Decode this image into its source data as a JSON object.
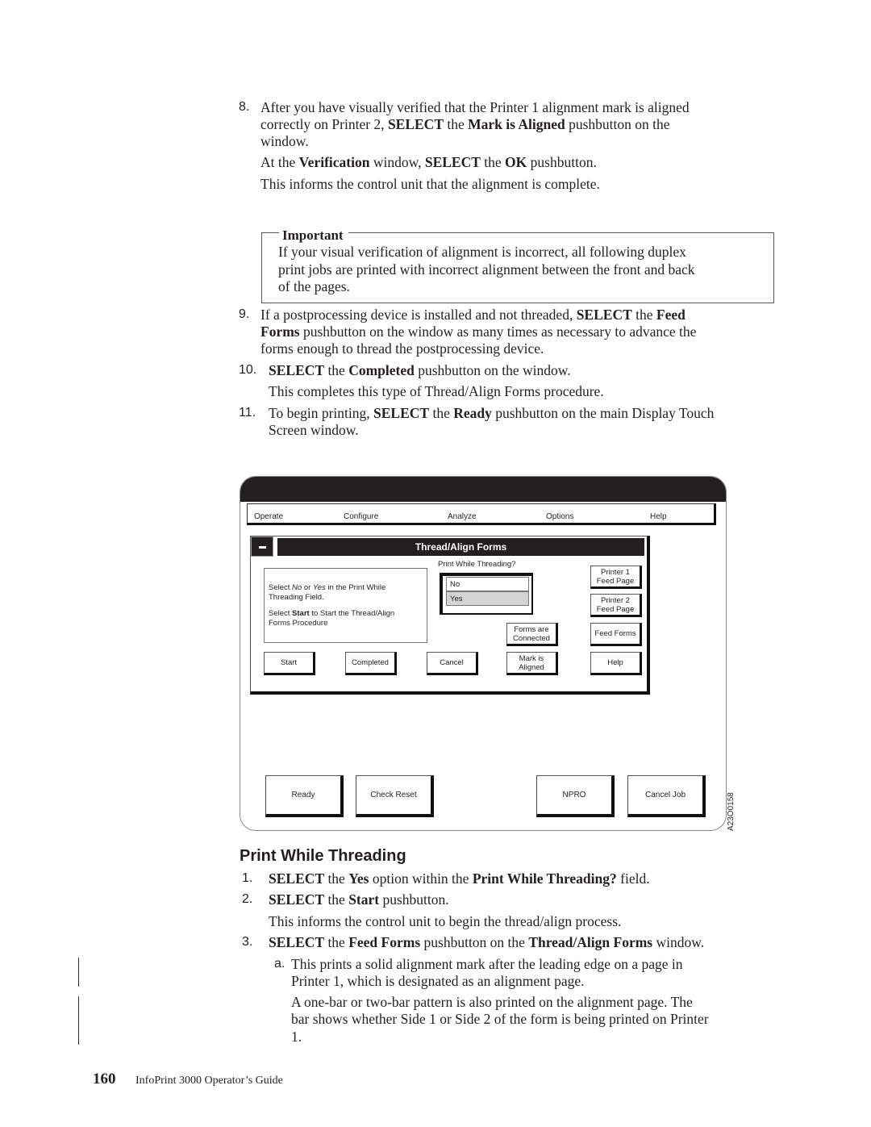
{
  "steps_top": [
    {
      "number": "8.",
      "lines": [
        "After you have visually verified that the Printer 1 alignment mark is aligned",
        [
          "correctly on Printer 2, ",
          {
            "b": "SELECT"
          },
          " the ",
          {
            "b": "Mark is Aligned"
          },
          " pushbutton on the"
        ],
        "window."
      ],
      "para2": [
        [
          "At the ",
          {
            "b": "Verification"
          },
          " window, ",
          {
            "b": "SELECT"
          },
          " the ",
          {
            "b": "OK"
          },
          " pushbutton."
        ]
      ],
      "para3": "This informs the control unit that the alignment is complete."
    }
  ],
  "step8": {
    "number": "8.",
    "line1": "After you have visually verified that the Printer 1 alignment mark is aligned",
    "line2_a": "correctly on Printer 2, ",
    "line2_b": "SELECT",
    "line2_c": " the ",
    "line2_d": "Mark is Aligned",
    "line2_e": " pushbutton on the",
    "line3": "window.",
    "p2_a": "At the ",
    "p2_b": "Verification",
    "p2_c": " window, ",
    "p2_d": "SELECT",
    "p2_e": " the ",
    "p2_f": "OK",
    "p2_g": " pushbutton.",
    "p3": "This informs the control unit that the alignment is complete."
  },
  "important": {
    "label": "Important",
    "line1": "If your visual verification of alignment is incorrect, all following duplex",
    "line2": "print jobs are printed with incorrect alignment between the front and back",
    "line3": "of the pages."
  },
  "step9": {
    "number": "9.",
    "l1_a": "If a postprocessing device is installed and not threaded, ",
    "l1_b": "SELECT",
    "l1_c": " the ",
    "l1_d": "Feed",
    "l2_a": "Forms",
    "l2_b": " pushbutton on the window as many times as necessary to advance the",
    "l3": "forms enough to thread the postprocessing device."
  },
  "step10": {
    "number": "10.",
    "l1_a": "SELECT",
    "l1_b": " the ",
    "l1_c": "Completed",
    "l1_d": " pushbutton on the window.",
    "p2": "This completes this type of Thread/Align Forms procedure."
  },
  "step11": {
    "number": "11.",
    "l1_a": "To begin printing, ",
    "l1_b": "SELECT",
    "l1_c": " the ",
    "l1_d": "Ready",
    "l1_e": " pushbutton on the main Display Touch",
    "l2": "Screen window."
  },
  "screen": {
    "menu": [
      "Operate",
      "Configure",
      "Analyze",
      "Options",
      "Help"
    ],
    "dialog_title": "Thread/Align Forms",
    "info_line1_a": "Select ",
    "info_line1_b": "No",
    "info_line1_c": " or ",
    "info_line1_d": "Yes",
    "info_line1_e": " in the Print While",
    "info_line2": "Threading Field.",
    "info_line3_a": "Select ",
    "info_line3_b": "Start",
    "info_line3_c": " to Start the Thread/Align",
    "info_line4": "Forms Procedure",
    "pwt_label": "Print While Threading?",
    "pwt_options": [
      "No",
      "Yes"
    ],
    "pwt_selected": "Yes",
    "buttons": {
      "printer1_l1": "Printer 1",
      "printer1_l2": "Feed Page",
      "printer2_l1": "Printer 2",
      "printer2_l2": "Feed Page",
      "forms_connected_l1": "Forms are",
      "forms_connected_l2": "Connected",
      "feed_forms": "Feed Forms",
      "start": "Start",
      "completed": "Completed",
      "cancel": "Cancel",
      "mark_aligned_l1": "Mark is",
      "mark_aligned_l2": "Aligned",
      "help": "Help"
    },
    "bottom_buttons": [
      "Ready",
      "Check Reset",
      "NPRO",
      "Cancel Job"
    ],
    "figure_id": "A23O0158",
    "colors": {
      "selected_option": "#d4d4d4",
      "dark": "#231f20"
    }
  },
  "section": {
    "title": "Print While Threading",
    "s1_num": "1.",
    "s1_a": "SELECT",
    "s1_b": " the ",
    "s1_c": "Yes",
    "s1_d": " option within the ",
    "s1_e": "Print While Threading?",
    "s1_f": " field.",
    "s2_num": "2.",
    "s2_a": "SELECT",
    "s2_b": " the ",
    "s2_c": "Start",
    "s2_d": " pushbutton.",
    "s2_p": "This informs the control unit to begin the thread/align process.",
    "s3_num": "3.",
    "s3_a": "SELECT",
    "s3_b": " the ",
    "s3_c": "Feed Forms",
    "s3_d": " pushbutton on the ",
    "s3_e": "Thread/Align Forms",
    "s3_f": " window.",
    "sa_num": "a.",
    "sa_l1": "This prints a solid alignment mark after the leading edge on a page in",
    "sa_l2": "Printer 1, which is designated as an alignment page.",
    "sa_p1": "A one-bar or two-bar pattern is also printed on the alignment page. The",
    "sa_p2": "bar shows whether Side 1 or Side 2 of the form is being printed on Printer",
    "sa_p3": "1."
  },
  "footer": {
    "page_number": "160",
    "book_title": "InfoPrint 3000 Operator’s Guide"
  }
}
